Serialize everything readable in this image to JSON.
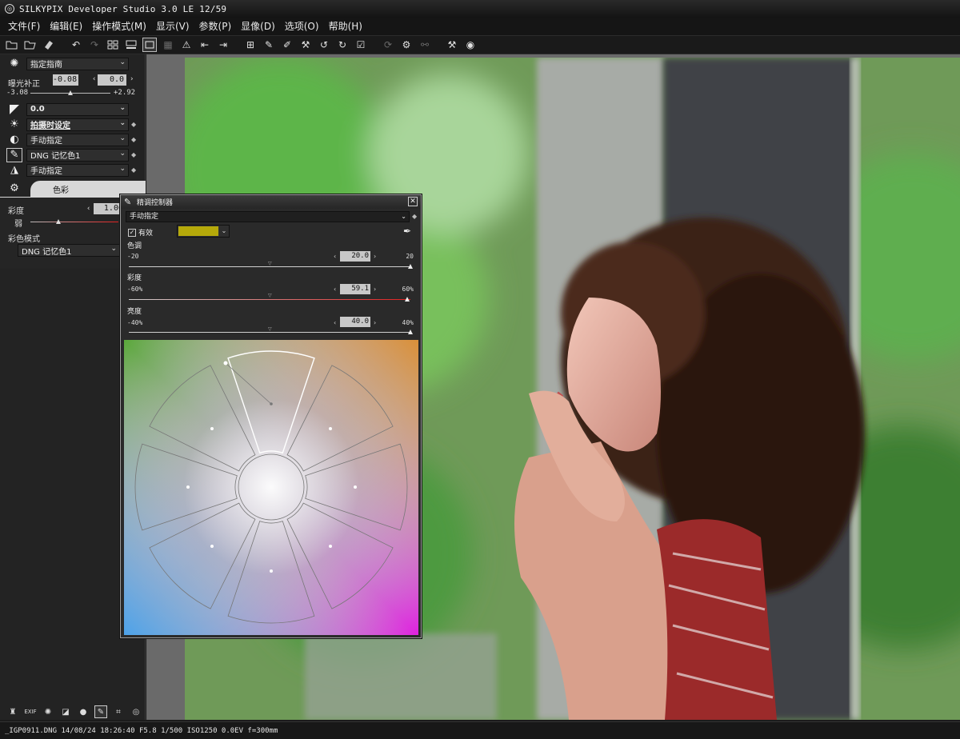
{
  "window": {
    "title": "SILKYPIX Developer Studio 3.0 LE   12/59"
  },
  "menu": [
    "文件(F)",
    "编辑(E)",
    "操作模式(M)",
    "显示(V)",
    "参数(P)",
    "显像(D)",
    "选项(O)",
    "帮助(H)"
  ],
  "left_panel": {
    "white_balance": "指定指南",
    "exposure_label": "曝光补正",
    "exposure_value": "-0.08",
    "exposure_value2": "0.0",
    "exposure_min": "-3.08",
    "exposure_max": "+2.92",
    "tone": "0.0",
    "sharpness": "拍摄时设定",
    "contrast": "手动指定",
    "color_mode": "DNG 记忆色1",
    "noise": "手动指定",
    "tab_label": "色彩",
    "saturation_label": "彩度",
    "saturation_value": "1.00",
    "weak_label": "弱",
    "color_mode_label": "彩色模式",
    "color_mode_select": "DNG 记忆色1"
  },
  "dialog": {
    "title": "精调控制器",
    "preset": "手动指定",
    "enabled_label": "有效",
    "swatch_color": "#b5a90a",
    "hue": {
      "label": "色调",
      "min": "-20",
      "max": "20",
      "value": "20.0",
      "fraction": 1.0
    },
    "saturation": {
      "label": "彩度",
      "min": "-60%",
      "max": "60%",
      "value": "59.1",
      "fraction": 0.99
    },
    "lightness": {
      "label": "亮度",
      "min": "-40%",
      "max": "40%",
      "value": "40.0",
      "fraction": 1.0
    }
  },
  "status": {
    "text": "_IGP0911.DNG 14/08/24 18:26:40 F5.8 1/500 ISO1250 0.0EV f=300mm"
  },
  "icons": {
    "toolbar": [
      "open-icon",
      "open-folder-icon",
      "save-icon",
      "undo-icon",
      "redo-icon",
      "grid-view-icon",
      "filmstrip-icon",
      "single-view-icon",
      "compare-icon",
      "warning-icon",
      "prev-icon",
      "next-icon",
      "grid-overlay-icon",
      "pen-icon",
      "brush-icon",
      "eyedropper-icon",
      "rotate-left-icon",
      "rotate-right-icon",
      "check-icon",
      "refresh-icon",
      "batch-icon",
      "link-icon",
      "hammer-icon",
      "color-icon"
    ],
    "accent": "#e02020"
  }
}
